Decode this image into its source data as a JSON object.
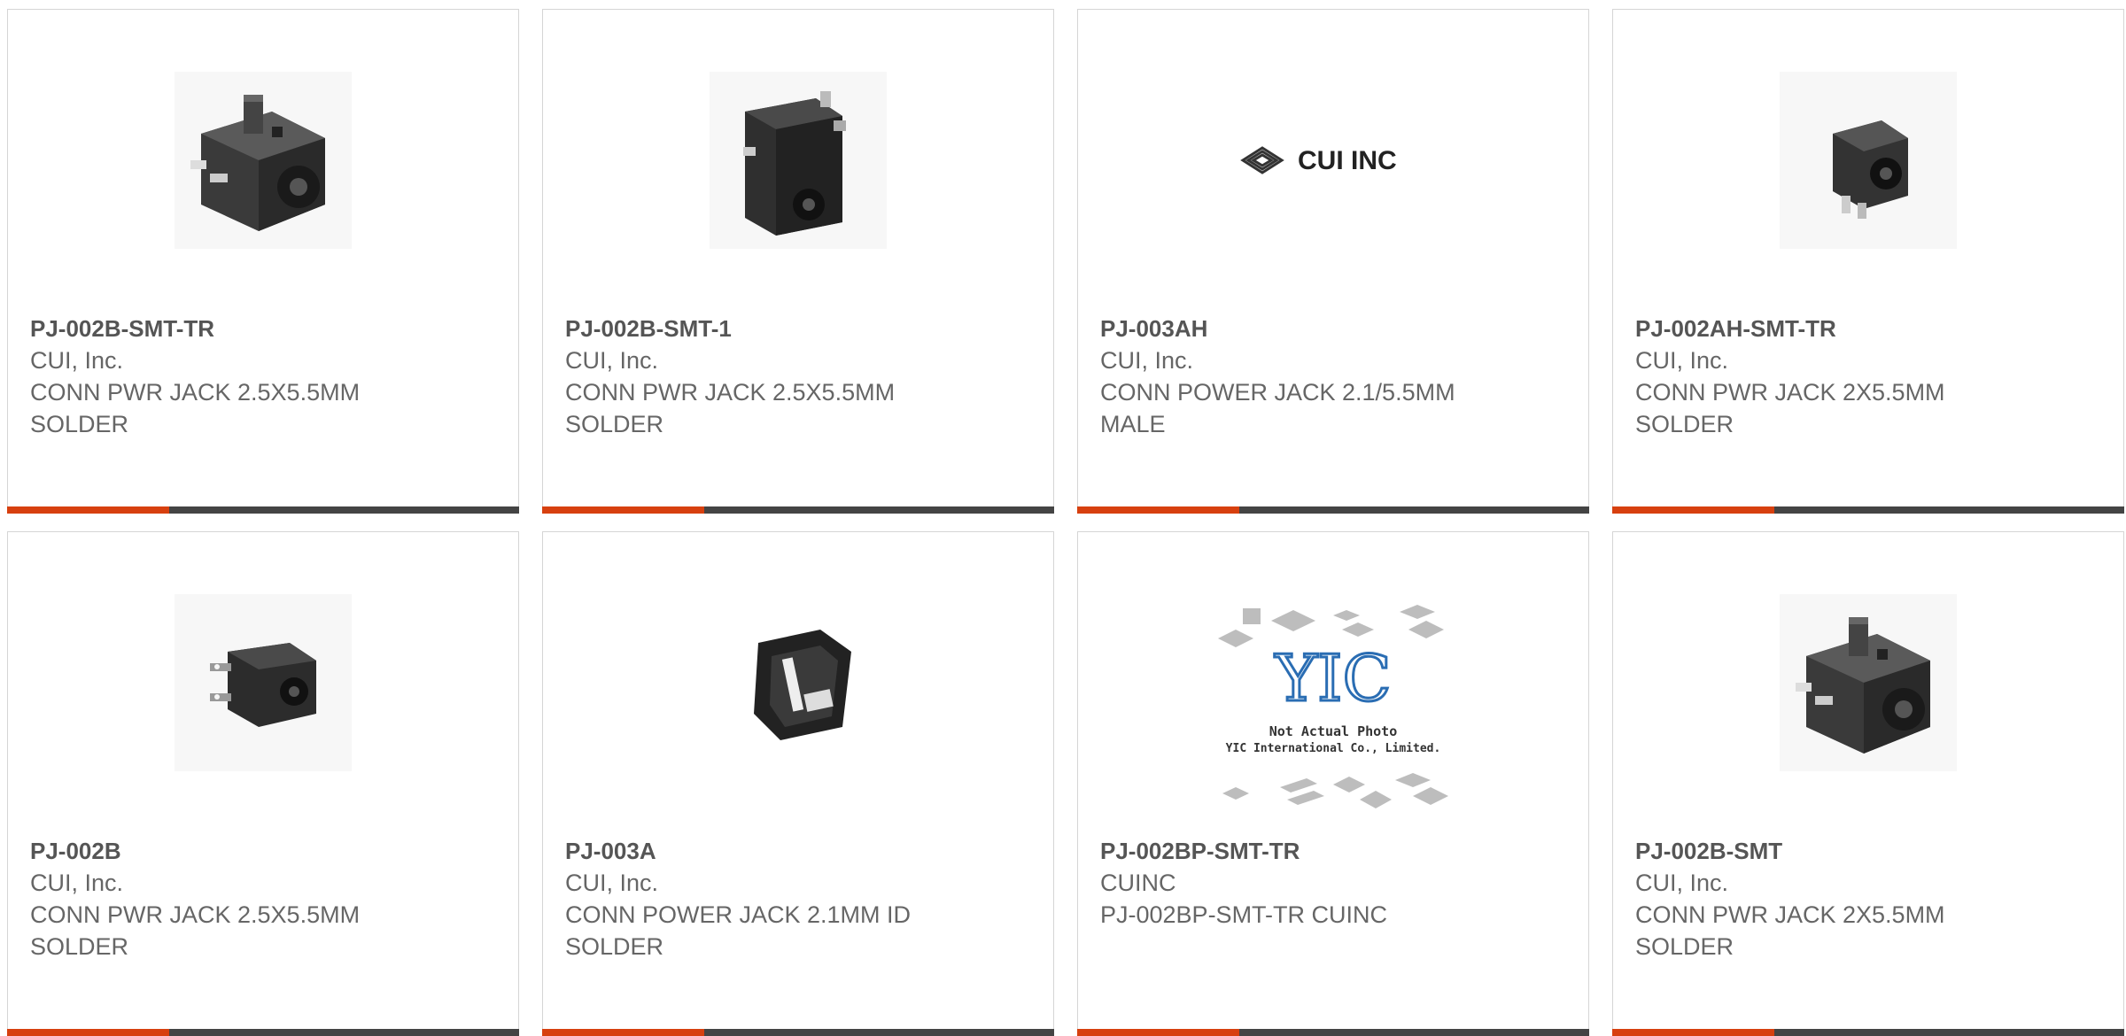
{
  "colors": {
    "accent": "#d7400f",
    "bar": "#444444",
    "title_text": "#555555",
    "body_text": "#666666",
    "card_border": "#d5d5d5"
  },
  "products": [
    {
      "part_number": "PJ-002B-SMT-TR",
      "manufacturer": "CUI, Inc.",
      "description": "CONN PWR JACK 2.5X5.5MM SOLDER",
      "image": "dc-jack-smt-photo"
    },
    {
      "part_number": "PJ-002B-SMT-1",
      "manufacturer": "CUI, Inc.",
      "description": "CONN PWR JACK 2.5X5.5MM SOLDER",
      "image": "dc-jack-compact-photo"
    },
    {
      "part_number": "PJ-003AH",
      "manufacturer": "CUI, Inc.",
      "description": "CONN POWER JACK 2.1/5.5MM MALE",
      "image": "cui-inc-logo",
      "logo_text": "CUI INC"
    },
    {
      "part_number": "PJ-002AH-SMT-TR",
      "manufacturer": "CUI, Inc.",
      "description": "CONN PWR JACK 2X5.5MM SOLDER",
      "image": "dc-jack-small-photo"
    },
    {
      "part_number": "PJ-002B",
      "manufacturer": "CUI, Inc.",
      "description": "CONN PWR JACK 2.5X5.5MM SOLDER",
      "image": "dc-jack-through-hole-photo"
    },
    {
      "part_number": "PJ-003A",
      "manufacturer": "CUI, Inc.",
      "description": "CONN POWER JACK 2.1MM ID SOLDER",
      "image": "dc-jack-top-view-photo"
    },
    {
      "part_number": "PJ-002BP-SMT-TR",
      "manufacturer": "CUINC",
      "description": "PJ-002BP-SMT-TR CUINC",
      "image": "yic-placeholder",
      "placeholder_lines": [
        "Not Actual Photo",
        "YIC International Co., Limited."
      ]
    },
    {
      "part_number": "PJ-002B-SMT",
      "manufacturer": "CUI, Inc.",
      "description": "CONN PWR JACK 2X5.5MM SOLDER",
      "image": "dc-jack-smt-photo"
    }
  ]
}
